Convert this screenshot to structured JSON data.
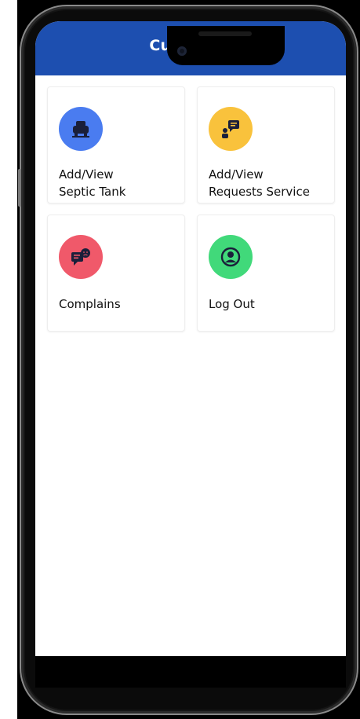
{
  "header": {
    "title": "Customer"
  },
  "cards": [
    {
      "label": "Add/View\nSeptic Tank",
      "icon": "septic-tank-icon",
      "color": "#4a7cf0"
    },
    {
      "label": "Add/View\nRequests Service",
      "icon": "service-request-icon",
      "color": "#f9c23c"
    },
    {
      "label": "Complains",
      "icon": "complaint-icon",
      "color": "#f0596a"
    },
    {
      "label": "Log Out",
      "icon": "user-logout-icon",
      "color": "#41d97a"
    }
  ]
}
